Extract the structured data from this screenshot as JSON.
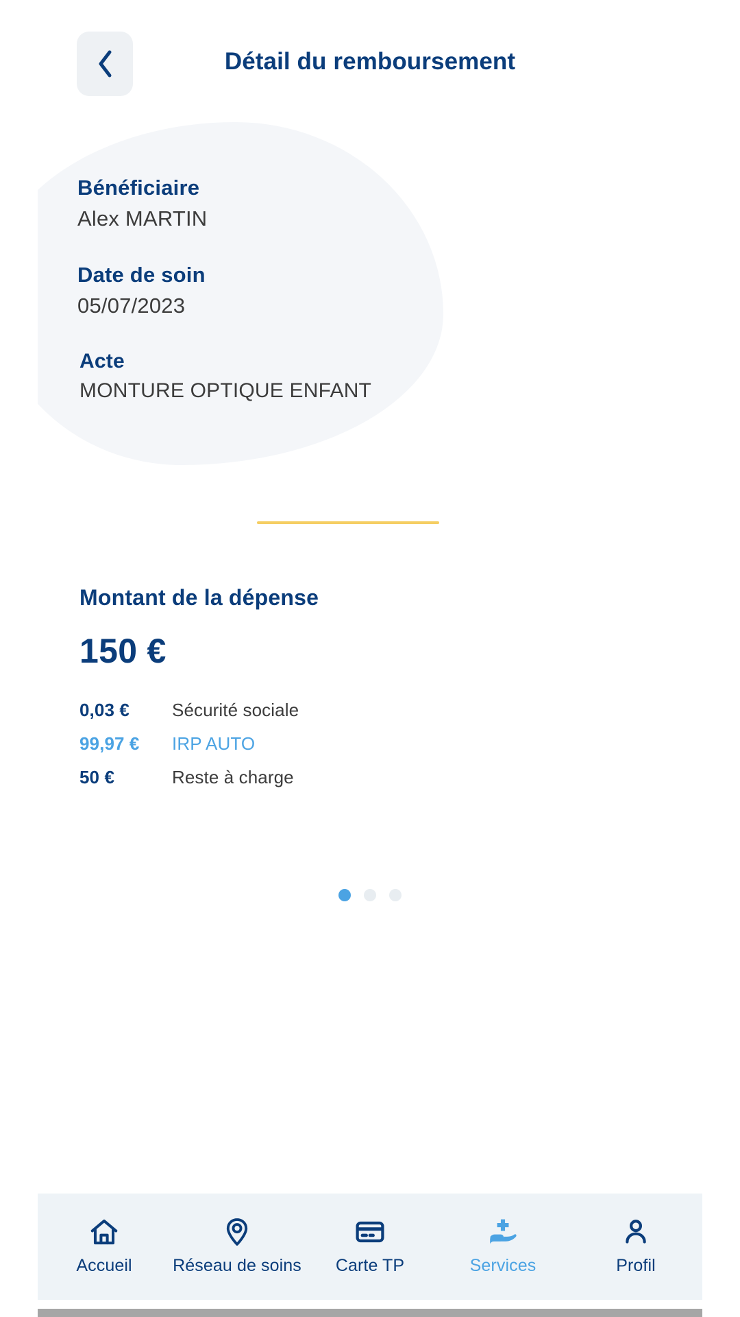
{
  "header": {
    "title": "Détail du remboursement",
    "back_icon": "chevron-left-icon"
  },
  "details": {
    "fields": [
      {
        "label": "Bénéficiaire",
        "value": "Alex MARTIN"
      },
      {
        "label": "Date de soin",
        "value": "05/07/2023"
      },
      {
        "label": "Acte",
        "value": "MONTURE OPTIQUE ENFANT"
      }
    ]
  },
  "amount": {
    "title": "Montant de la dépense",
    "total": "150 €",
    "breakdown": [
      {
        "amount": "0,03 €",
        "label": "Sécurité sociale",
        "accent": false
      },
      {
        "amount": "99,97 €",
        "label": "IRP AUTO",
        "accent": true
      },
      {
        "amount": "50 €",
        "label": "Reste à charge",
        "accent": false
      }
    ]
  },
  "pagination": {
    "count": 3,
    "active_index": 0
  },
  "bottom_nav": {
    "items": [
      {
        "label": "Accueil",
        "icon": "home-icon",
        "active": false
      },
      {
        "label": "Réseau de soins",
        "icon": "map-pin-icon",
        "active": false
      },
      {
        "label": "Carte TP",
        "icon": "credit-card-icon",
        "active": false
      },
      {
        "label": "Services",
        "icon": "hand-holding-cross-icon",
        "active": true
      },
      {
        "label": "Profil",
        "icon": "person-icon",
        "active": false
      }
    ]
  },
  "colors": {
    "navy": "#0b3d7b",
    "accent_blue": "#4ba3e3",
    "divider_yellow": "#f5ce63",
    "nav_background": "#eef3f7",
    "text_gray": "#3c3c3c"
  }
}
